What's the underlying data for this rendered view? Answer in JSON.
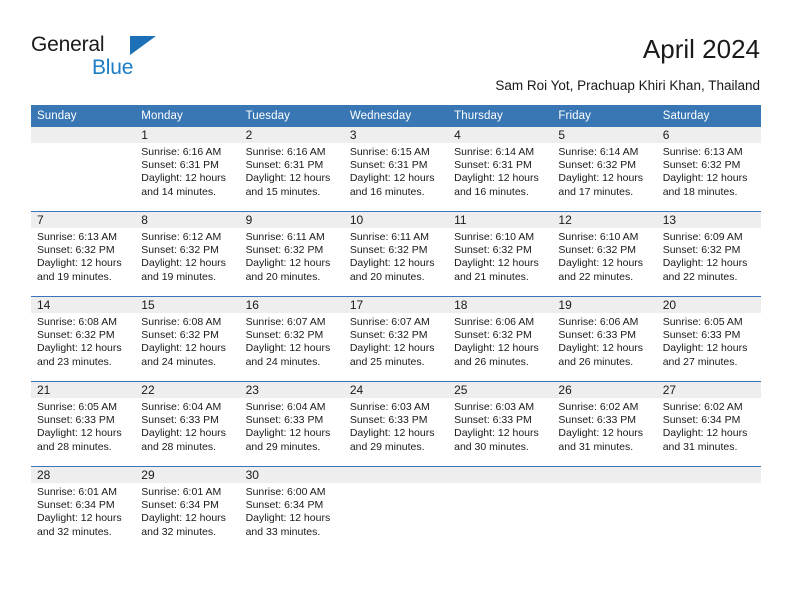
{
  "brand": {
    "name_line1": "General",
    "name_line2": "Blue",
    "triangle_icon": "blue-triangle-icon",
    "colors": {
      "header_blue": "#3876b4",
      "brand_blue": "#1c7cc4",
      "day_band_gray": "#eeeeee"
    }
  },
  "header": {
    "title": "April 2024",
    "subtitle": "Sam Roi Yot, Prachuap Khiri Khan, Thailand"
  },
  "calendar": {
    "weekday_headers": [
      "Sunday",
      "Monday",
      "Tuesday",
      "Wednesday",
      "Thursday",
      "Friday",
      "Saturday"
    ],
    "weeks": [
      [
        {
          "day": "",
          "sunrise": "",
          "sunset": "",
          "daylight_line1": "",
          "daylight_line2": ""
        },
        {
          "day": "1",
          "sunrise": "Sunrise: 6:16 AM",
          "sunset": "Sunset: 6:31 PM",
          "daylight_line1": "Daylight: 12 hours",
          "daylight_line2": "and 14 minutes."
        },
        {
          "day": "2",
          "sunrise": "Sunrise: 6:16 AM",
          "sunset": "Sunset: 6:31 PM",
          "daylight_line1": "Daylight: 12 hours",
          "daylight_line2": "and 15 minutes."
        },
        {
          "day": "3",
          "sunrise": "Sunrise: 6:15 AM",
          "sunset": "Sunset: 6:31 PM",
          "daylight_line1": "Daylight: 12 hours",
          "daylight_line2": "and 16 minutes."
        },
        {
          "day": "4",
          "sunrise": "Sunrise: 6:14 AM",
          "sunset": "Sunset: 6:31 PM",
          "daylight_line1": "Daylight: 12 hours",
          "daylight_line2": "and 16 minutes."
        },
        {
          "day": "5",
          "sunrise": "Sunrise: 6:14 AM",
          "sunset": "Sunset: 6:32 PM",
          "daylight_line1": "Daylight: 12 hours",
          "daylight_line2": "and 17 minutes."
        },
        {
          "day": "6",
          "sunrise": "Sunrise: 6:13 AM",
          "sunset": "Sunset: 6:32 PM",
          "daylight_line1": "Daylight: 12 hours",
          "daylight_line2": "and 18 minutes."
        }
      ],
      [
        {
          "day": "7",
          "sunrise": "Sunrise: 6:13 AM",
          "sunset": "Sunset: 6:32 PM",
          "daylight_line1": "Daylight: 12 hours",
          "daylight_line2": "and 19 minutes."
        },
        {
          "day": "8",
          "sunrise": "Sunrise: 6:12 AM",
          "sunset": "Sunset: 6:32 PM",
          "daylight_line1": "Daylight: 12 hours",
          "daylight_line2": "and 19 minutes."
        },
        {
          "day": "9",
          "sunrise": "Sunrise: 6:11 AM",
          "sunset": "Sunset: 6:32 PM",
          "daylight_line1": "Daylight: 12 hours",
          "daylight_line2": "and 20 minutes."
        },
        {
          "day": "10",
          "sunrise": "Sunrise: 6:11 AM",
          "sunset": "Sunset: 6:32 PM",
          "daylight_line1": "Daylight: 12 hours",
          "daylight_line2": "and 20 minutes."
        },
        {
          "day": "11",
          "sunrise": "Sunrise: 6:10 AM",
          "sunset": "Sunset: 6:32 PM",
          "daylight_line1": "Daylight: 12 hours",
          "daylight_line2": "and 21 minutes."
        },
        {
          "day": "12",
          "sunrise": "Sunrise: 6:10 AM",
          "sunset": "Sunset: 6:32 PM",
          "daylight_line1": "Daylight: 12 hours",
          "daylight_line2": "and 22 minutes."
        },
        {
          "day": "13",
          "sunrise": "Sunrise: 6:09 AM",
          "sunset": "Sunset: 6:32 PM",
          "daylight_line1": "Daylight: 12 hours",
          "daylight_line2": "and 22 minutes."
        }
      ],
      [
        {
          "day": "14",
          "sunrise": "Sunrise: 6:08 AM",
          "sunset": "Sunset: 6:32 PM",
          "daylight_line1": "Daylight: 12 hours",
          "daylight_line2": "and 23 minutes."
        },
        {
          "day": "15",
          "sunrise": "Sunrise: 6:08 AM",
          "sunset": "Sunset: 6:32 PM",
          "daylight_line1": "Daylight: 12 hours",
          "daylight_line2": "and 24 minutes."
        },
        {
          "day": "16",
          "sunrise": "Sunrise: 6:07 AM",
          "sunset": "Sunset: 6:32 PM",
          "daylight_line1": "Daylight: 12 hours",
          "daylight_line2": "and 24 minutes."
        },
        {
          "day": "17",
          "sunrise": "Sunrise: 6:07 AM",
          "sunset": "Sunset: 6:32 PM",
          "daylight_line1": "Daylight: 12 hours",
          "daylight_line2": "and 25 minutes."
        },
        {
          "day": "18",
          "sunrise": "Sunrise: 6:06 AM",
          "sunset": "Sunset: 6:32 PM",
          "daylight_line1": "Daylight: 12 hours",
          "daylight_line2": "and 26 minutes."
        },
        {
          "day": "19",
          "sunrise": "Sunrise: 6:06 AM",
          "sunset": "Sunset: 6:33 PM",
          "daylight_line1": "Daylight: 12 hours",
          "daylight_line2": "and 26 minutes."
        },
        {
          "day": "20",
          "sunrise": "Sunrise: 6:05 AM",
          "sunset": "Sunset: 6:33 PM",
          "daylight_line1": "Daylight: 12 hours",
          "daylight_line2": "and 27 minutes."
        }
      ],
      [
        {
          "day": "21",
          "sunrise": "Sunrise: 6:05 AM",
          "sunset": "Sunset: 6:33 PM",
          "daylight_line1": "Daylight: 12 hours",
          "daylight_line2": "and 28 minutes."
        },
        {
          "day": "22",
          "sunrise": "Sunrise: 6:04 AM",
          "sunset": "Sunset: 6:33 PM",
          "daylight_line1": "Daylight: 12 hours",
          "daylight_line2": "and 28 minutes."
        },
        {
          "day": "23",
          "sunrise": "Sunrise: 6:04 AM",
          "sunset": "Sunset: 6:33 PM",
          "daylight_line1": "Daylight: 12 hours",
          "daylight_line2": "and 29 minutes."
        },
        {
          "day": "24",
          "sunrise": "Sunrise: 6:03 AM",
          "sunset": "Sunset: 6:33 PM",
          "daylight_line1": "Daylight: 12 hours",
          "daylight_line2": "and 29 minutes."
        },
        {
          "day": "25",
          "sunrise": "Sunrise: 6:03 AM",
          "sunset": "Sunset: 6:33 PM",
          "daylight_line1": "Daylight: 12 hours",
          "daylight_line2": "and 30 minutes."
        },
        {
          "day": "26",
          "sunrise": "Sunrise: 6:02 AM",
          "sunset": "Sunset: 6:33 PM",
          "daylight_line1": "Daylight: 12 hours",
          "daylight_line2": "and 31 minutes."
        },
        {
          "day": "27",
          "sunrise": "Sunrise: 6:02 AM",
          "sunset": "Sunset: 6:34 PM",
          "daylight_line1": "Daylight: 12 hours",
          "daylight_line2": "and 31 minutes."
        }
      ],
      [
        {
          "day": "28",
          "sunrise": "Sunrise: 6:01 AM",
          "sunset": "Sunset: 6:34 PM",
          "daylight_line1": "Daylight: 12 hours",
          "daylight_line2": "and 32 minutes."
        },
        {
          "day": "29",
          "sunrise": "Sunrise: 6:01 AM",
          "sunset": "Sunset: 6:34 PM",
          "daylight_line1": "Daylight: 12 hours",
          "daylight_line2": "and 32 minutes."
        },
        {
          "day": "30",
          "sunrise": "Sunrise: 6:00 AM",
          "sunset": "Sunset: 6:34 PM",
          "daylight_line1": "Daylight: 12 hours",
          "daylight_line2": "and 33 minutes."
        },
        {
          "day": "",
          "sunrise": "",
          "sunset": "",
          "daylight_line1": "",
          "daylight_line2": ""
        },
        {
          "day": "",
          "sunrise": "",
          "sunset": "",
          "daylight_line1": "",
          "daylight_line2": ""
        },
        {
          "day": "",
          "sunrise": "",
          "sunset": "",
          "daylight_line1": "",
          "daylight_line2": ""
        },
        {
          "day": "",
          "sunrise": "",
          "sunset": "",
          "daylight_line1": "",
          "daylight_line2": ""
        }
      ]
    ]
  }
}
